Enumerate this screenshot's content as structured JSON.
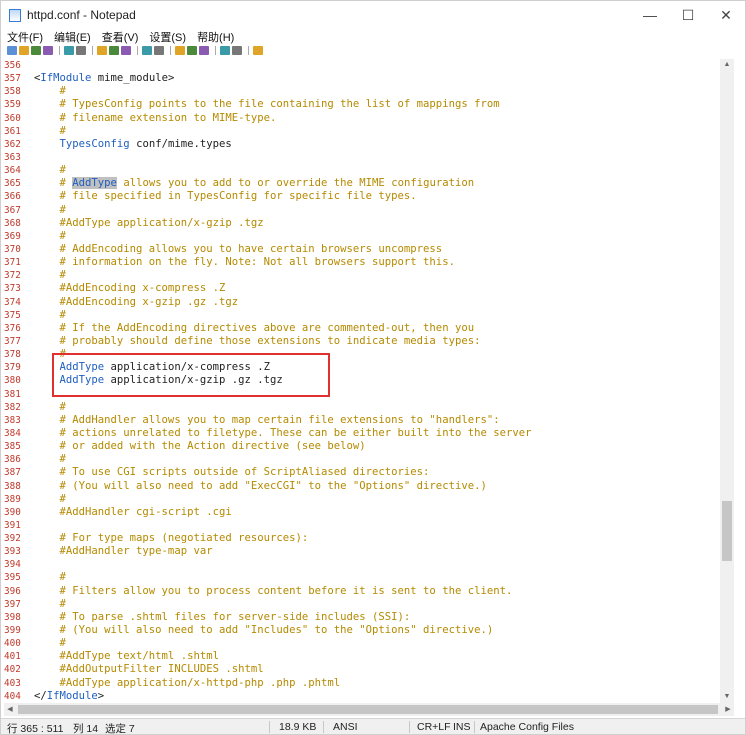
{
  "window": {
    "title": "httpd.conf - Notepad",
    "minimize": "—",
    "maximize": "☐",
    "close": "✕"
  },
  "menu": [
    {
      "label": "文件(F)",
      "name": "menu-file"
    },
    {
      "label": "编辑(E)",
      "name": "menu-edit"
    },
    {
      "label": "查看(V)",
      "name": "menu-view"
    },
    {
      "label": "设置(S)",
      "name": "menu-settings"
    },
    {
      "label": "帮助(H)",
      "name": "menu-help"
    }
  ],
  "toolbar": [
    "new-file-icon",
    "open-file-icon",
    "save-icon",
    "save-all-icon",
    "sep",
    "undo-icon",
    "redo-icon",
    "sep",
    "cut-icon",
    "copy-icon",
    "paste-icon",
    "sep",
    "find-icon",
    "replace-icon",
    "sep",
    "goto-icon",
    "zoom-in-icon",
    "zoom-out-icon",
    "sep",
    "wordwrap-icon",
    "settings-icon",
    "sep",
    "run-icon"
  ],
  "colors": {
    "line_number": "#c0392b",
    "comment": "#b58a00",
    "keyword": "#1f5fbf",
    "selection": "#c0c0c0",
    "annotation_box": "#e03030"
  },
  "lines": [
    {
      "n": "356",
      "t": []
    },
    {
      "n": "357",
      "t": [
        {
          "c": "text",
          "s": "<"
        },
        {
          "c": "keyword",
          "s": "IfModule"
        },
        {
          "c": "text",
          "s": " mime_module>"
        }
      ]
    },
    {
      "n": "358",
      "t": [
        {
          "c": "comment",
          "s": "    #"
        }
      ]
    },
    {
      "n": "359",
      "t": [
        {
          "c": "comment",
          "s": "    # TypesConfig points to the file containing the list of mappings from"
        }
      ]
    },
    {
      "n": "360",
      "t": [
        {
          "c": "comment",
          "s": "    # filename extension to MIME-type."
        }
      ]
    },
    {
      "n": "361",
      "t": [
        {
          "c": "comment",
          "s": "    #"
        }
      ]
    },
    {
      "n": "362",
      "t": [
        {
          "c": "text",
          "s": "    "
        },
        {
          "c": "keyword",
          "s": "TypesConfig"
        },
        {
          "c": "text",
          "s": " conf/mime.types"
        }
      ]
    },
    {
      "n": "363",
      "t": []
    },
    {
      "n": "364",
      "t": [
        {
          "c": "comment",
          "s": "    #"
        }
      ]
    },
    {
      "n": "365",
      "t": [
        {
          "c": "comment",
          "s": "    # "
        },
        {
          "c": "sel",
          "s": "AddType"
        },
        {
          "c": "comment",
          "s": " allows you to add to or override the MIME configuration"
        }
      ]
    },
    {
      "n": "366",
      "t": [
        {
          "c": "comment",
          "s": "    # file specified in TypesConfig for specific file types."
        }
      ]
    },
    {
      "n": "367",
      "t": [
        {
          "c": "comment",
          "s": "    #"
        }
      ]
    },
    {
      "n": "368",
      "t": [
        {
          "c": "comment",
          "s": "    #AddType application/x-gzip .tgz"
        }
      ]
    },
    {
      "n": "369",
      "t": [
        {
          "c": "comment",
          "s": "    #"
        }
      ]
    },
    {
      "n": "370",
      "t": [
        {
          "c": "comment",
          "s": "    # AddEncoding allows you to have certain browsers uncompress"
        }
      ]
    },
    {
      "n": "371",
      "t": [
        {
          "c": "comment",
          "s": "    # information on the fly. Note: Not all browsers support this."
        }
      ]
    },
    {
      "n": "372",
      "t": [
        {
          "c": "comment",
          "s": "    #"
        }
      ]
    },
    {
      "n": "373",
      "t": [
        {
          "c": "comment",
          "s": "    #AddEncoding x-compress .Z"
        }
      ]
    },
    {
      "n": "374",
      "t": [
        {
          "c": "comment",
          "s": "    #AddEncoding x-gzip .gz .tgz"
        }
      ]
    },
    {
      "n": "375",
      "t": [
        {
          "c": "comment",
          "s": "    #"
        }
      ]
    },
    {
      "n": "376",
      "t": [
        {
          "c": "comment",
          "s": "    # If the AddEncoding directives above are commented-out, then you"
        }
      ]
    },
    {
      "n": "377",
      "t": [
        {
          "c": "comment",
          "s": "    # probably should define those extensions to indicate media types:"
        }
      ]
    },
    {
      "n": "378",
      "t": [
        {
          "c": "comment",
          "s": "    #"
        }
      ]
    },
    {
      "n": "379",
      "t": [
        {
          "c": "text",
          "s": "    "
        },
        {
          "c": "keyword",
          "s": "AddType"
        },
        {
          "c": "text",
          "s": " application/x-compress .Z"
        }
      ]
    },
    {
      "n": "380",
      "t": [
        {
          "c": "text",
          "s": "    "
        },
        {
          "c": "keyword",
          "s": "AddType"
        },
        {
          "c": "text",
          "s": " application/x-gzip .gz .tgz"
        }
      ]
    },
    {
      "n": "381",
      "t": []
    },
    {
      "n": "382",
      "t": [
        {
          "c": "comment",
          "s": "    #"
        }
      ]
    },
    {
      "n": "383",
      "t": [
        {
          "c": "comment",
          "s": "    # AddHandler allows you to map certain file extensions to \"handlers\":"
        }
      ]
    },
    {
      "n": "384",
      "t": [
        {
          "c": "comment",
          "s": "    # actions unrelated to filetype. These can be either built into the server"
        }
      ]
    },
    {
      "n": "385",
      "t": [
        {
          "c": "comment",
          "s": "    # or added with the Action directive (see below)"
        }
      ]
    },
    {
      "n": "386",
      "t": [
        {
          "c": "comment",
          "s": "    #"
        }
      ]
    },
    {
      "n": "387",
      "t": [
        {
          "c": "comment",
          "s": "    # To use CGI scripts outside of ScriptAliased directories:"
        }
      ]
    },
    {
      "n": "388",
      "t": [
        {
          "c": "comment",
          "s": "    # (You will also need to add \"ExecCGI\" to the \"Options\" directive.)"
        }
      ]
    },
    {
      "n": "389",
      "t": [
        {
          "c": "comment",
          "s": "    #"
        }
      ]
    },
    {
      "n": "390",
      "t": [
        {
          "c": "comment",
          "s": "    #AddHandler cgi-script .cgi"
        }
      ]
    },
    {
      "n": "391",
      "t": []
    },
    {
      "n": "392",
      "t": [
        {
          "c": "comment",
          "s": "    # For type maps (negotiated resources):"
        }
      ]
    },
    {
      "n": "393",
      "t": [
        {
          "c": "comment",
          "s": "    #AddHandler type-map var"
        }
      ]
    },
    {
      "n": "394",
      "t": []
    },
    {
      "n": "395",
      "t": [
        {
          "c": "comment",
          "s": "    #"
        }
      ]
    },
    {
      "n": "396",
      "t": [
        {
          "c": "comment",
          "s": "    # Filters allow you to process content before it is sent to the client."
        }
      ]
    },
    {
      "n": "397",
      "t": [
        {
          "c": "comment",
          "s": "    #"
        }
      ]
    },
    {
      "n": "398",
      "t": [
        {
          "c": "comment",
          "s": "    # To parse .shtml files for server-side includes (SSI):"
        }
      ]
    },
    {
      "n": "399",
      "t": [
        {
          "c": "comment",
          "s": "    # (You will also need to add \"Includes\" to the \"Options\" directive.)"
        }
      ]
    },
    {
      "n": "400",
      "t": [
        {
          "c": "comment",
          "s": "    #"
        }
      ]
    },
    {
      "n": "401",
      "t": [
        {
          "c": "comment",
          "s": "    #AddType text/html .shtml"
        }
      ]
    },
    {
      "n": "402",
      "t": [
        {
          "c": "comment",
          "s": "    #AddOutputFilter INCLUDES .shtml"
        }
      ]
    },
    {
      "n": "403",
      "t": [
        {
          "c": "comment",
          "s": "    #AddType application/x-httpd-php .php .phtml"
        }
      ]
    },
    {
      "n": "404",
      "t": [
        {
          "c": "text",
          "s": "</"
        },
        {
          "c": "keyword",
          "s": "IfModule"
        },
        {
          "c": "text",
          "s": ">"
        }
      ]
    }
  ],
  "status": {
    "position": "行 365 : 511",
    "column": "列 14",
    "selection": "选定 7",
    "size": "18.9 KB",
    "encoding": "ANSI",
    "eol": "CR+LF",
    "mode": "INS",
    "language": "Apache Config Files"
  }
}
